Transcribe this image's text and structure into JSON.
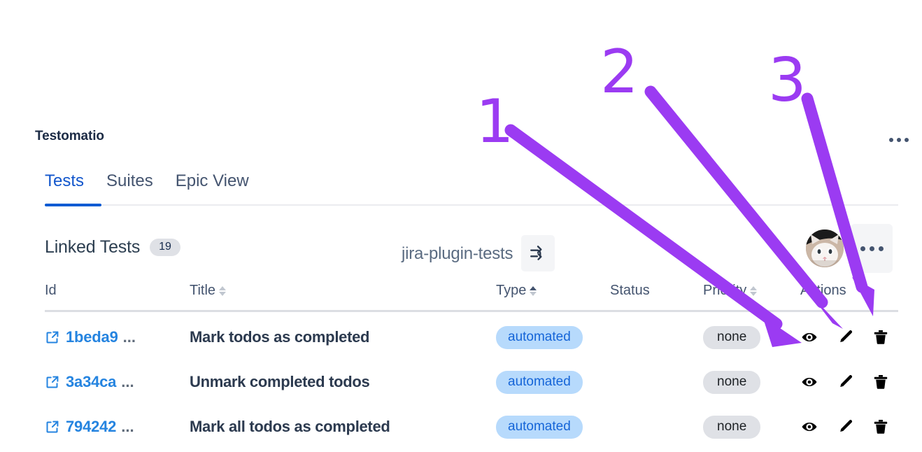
{
  "panel": {
    "title": "Testomatio",
    "more_menu_label": "•••"
  },
  "tabs": [
    {
      "label": "Tests",
      "active": true
    },
    {
      "label": "Suites",
      "active": false
    },
    {
      "label": "Epic View",
      "active": false
    }
  ],
  "toolbar": {
    "linked_tests_label": "Linked Tests",
    "linked_tests_count": "19",
    "project_name": "jira-plugin-tests",
    "sync_icon": "branch-sync-icon",
    "avatar_alt": "user-avatar-cat",
    "more_menu_label": "•••"
  },
  "table": {
    "columns": [
      {
        "key": "id",
        "label": "Id",
        "sortable": false,
        "sort": "none"
      },
      {
        "key": "title",
        "label": "Title",
        "sortable": true,
        "sort": "none"
      },
      {
        "key": "type",
        "label": "Type",
        "sortable": true,
        "sort": "asc"
      },
      {
        "key": "status",
        "label": "Status",
        "sortable": false,
        "sort": "none"
      },
      {
        "key": "priority",
        "label": "Priority",
        "sortable": true,
        "sort": "none"
      },
      {
        "key": "actions",
        "label": "Actions",
        "sortable": false,
        "sort": "none"
      }
    ],
    "rows": [
      {
        "id": "1beda9",
        "id_truncated": "...",
        "title": "Mark todos as completed",
        "type": "automated",
        "status": "",
        "priority": "none",
        "actions": [
          "view",
          "edit",
          "delete"
        ]
      },
      {
        "id": "3a34ca",
        "id_truncated": "...",
        "title": "Unmark completed todos",
        "type": "automated",
        "status": "",
        "priority": "none",
        "actions": [
          "view",
          "edit",
          "delete"
        ]
      },
      {
        "id": "794242",
        "id_truncated": "...",
        "title": "Mark all todos as completed",
        "type": "automated",
        "status": "",
        "priority": "none",
        "actions": [
          "view",
          "edit",
          "delete"
        ]
      }
    ]
  },
  "annotations": {
    "color": "#9b3bf2",
    "markers": [
      {
        "label": "1",
        "points_to": "view-action-icon"
      },
      {
        "label": "2",
        "points_to": "edit-action-icon"
      },
      {
        "label": "3",
        "points_to": "delete-action-icon"
      }
    ]
  },
  "colors": {
    "accent_blue": "#0b5bd3",
    "link_blue": "#2584e0",
    "type_pill_bg": "#b7dafc",
    "type_pill_text": "#1565d8",
    "priority_pill_bg": "#dfe1e6",
    "text_dark": "#2c3a4f",
    "text_muted": "#44546f",
    "annotation_purple": "#9b3bf2"
  }
}
